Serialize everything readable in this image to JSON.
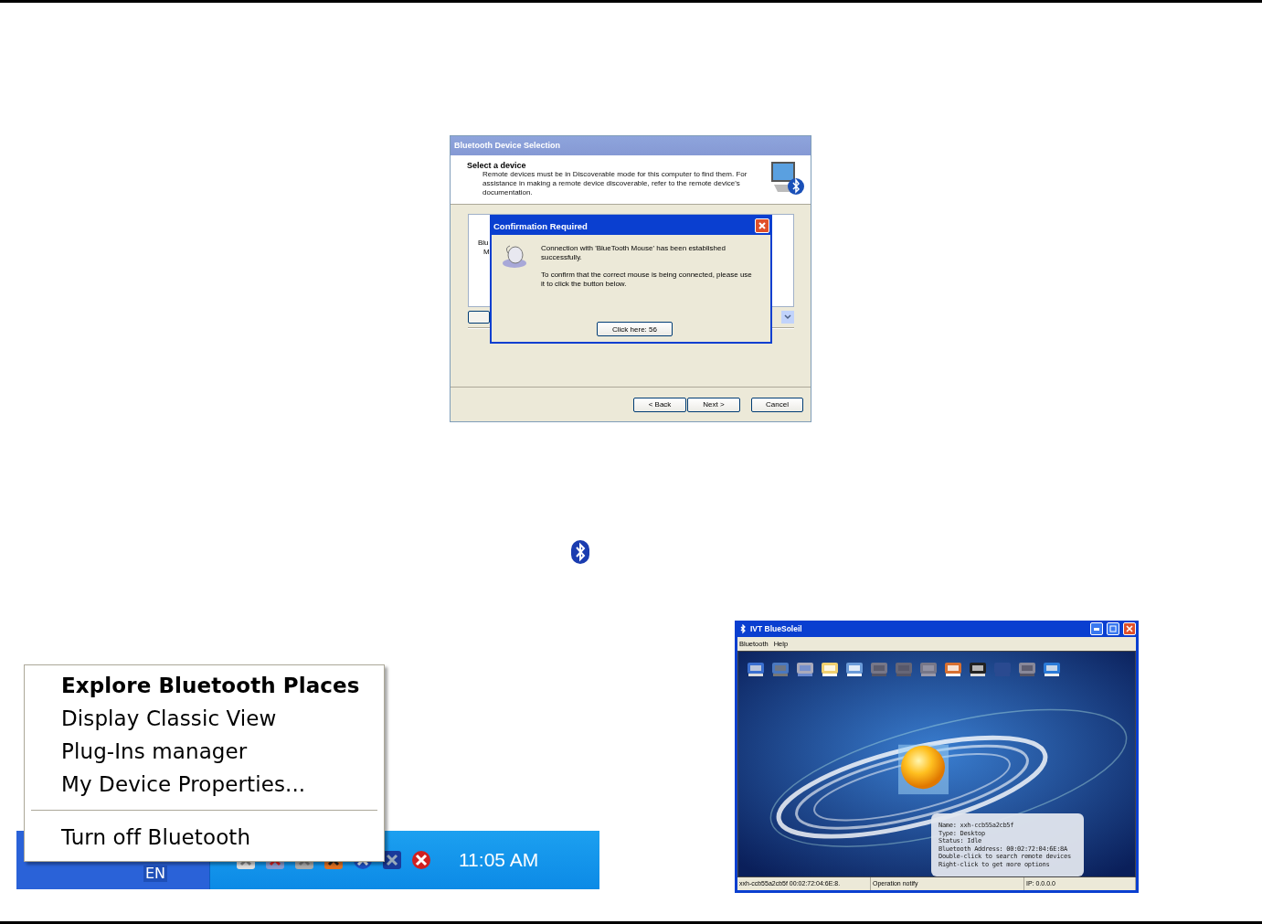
{
  "wizard": {
    "title": "Bluetooth Device Selection",
    "heading": "Select a device",
    "description": "Remote devices must be in Discoverable mode for this computer to find them. For assistance in making a remote device discoverable, refer to the remote device's documentation.",
    "list_fragments": [
      "Blu",
      "M"
    ],
    "buttons": [
      {
        "label": "< Back"
      },
      {
        "label": "Next >"
      },
      {
        "label": "Cancel"
      }
    ]
  },
  "confirmation": {
    "title": "Confirmation Required",
    "message": "Connection with 'BlueTooth Mouse' has been established successfully.",
    "instruction": "To confirm that the correct mouse is being connected, please use it to click the button below.",
    "button": "Click here: 56"
  },
  "tray_menu": {
    "items": [
      {
        "label": "Explore Bluetooth Places",
        "default": true
      },
      {
        "label": "Display Classic View",
        "default": false
      },
      {
        "label": "Plug-Ins manager",
        "default": false
      },
      {
        "label": "My Device Properties...",
        "default": false
      }
    ],
    "footer_items": [
      {
        "label": "Turn off Bluetooth",
        "default": false
      }
    ]
  },
  "taskbar": {
    "language": "EN",
    "clock": "11:05 AM"
  },
  "bluesoleil": {
    "title": "IVT BlueSoleil",
    "menu": [
      "Bluetooth",
      "Help"
    ],
    "tooltip_lines": [
      "Name: xxh-ccb55a2cb5f",
      "Type: Desktop",
      "Status: Idle",
      "Bluetooth Address: 00:02:72:04:6E:8A",
      "Double-click to search remote devices",
      "Right-click to get more options"
    ],
    "status_bar": [
      "xxh-ccb55a2cb5f 00:02:72:04:6E:8.",
      "Operation notify",
      "IP: 0.0.0.0"
    ]
  }
}
